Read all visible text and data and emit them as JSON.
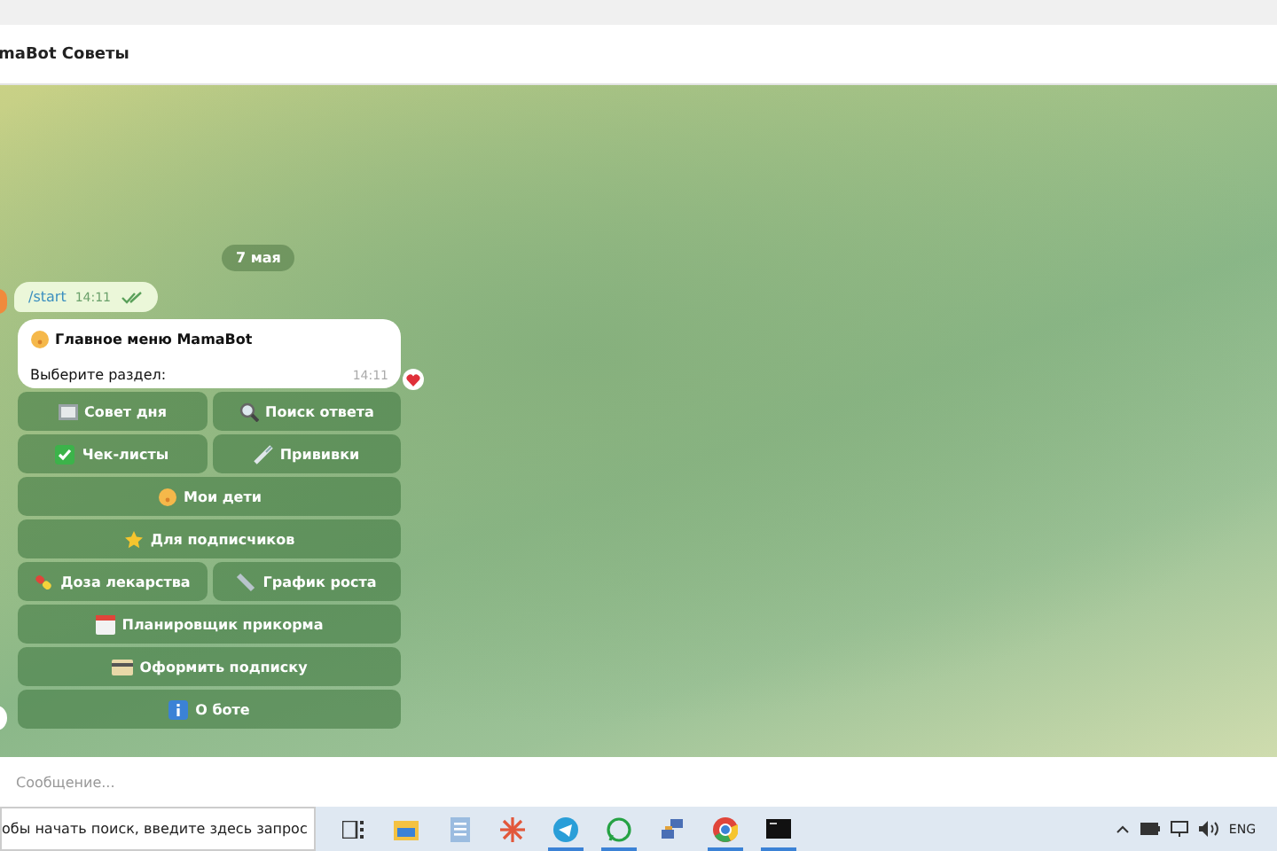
{
  "chat": {
    "title": "maBot Советы"
  },
  "date_badge": "7 мая",
  "outgoing": {
    "text": "/start",
    "time": "14:11",
    "read": true
  },
  "incoming": {
    "title": "Главное меню MamaBot",
    "text": "Выберите раздел:",
    "time": "14:11",
    "reacted": true
  },
  "keyboard": [
    [
      {
        "label": "Совет дня"
      },
      {
        "label": "Поиск ответа"
      }
    ],
    [
      {
        "label": "Чек-листы"
      },
      {
        "label": "Прививки"
      }
    ],
    [
      {
        "label": "Мои дети"
      }
    ],
    [
      {
        "label": "Для подписчиков"
      }
    ],
    [
      {
        "label": "Доза лекарства"
      },
      {
        "label": "График роста"
      }
    ],
    [
      {
        "label": "Планировщик прикорма"
      }
    ],
    [
      {
        "label": "Оформить подписку"
      }
    ],
    [
      {
        "label": "О боте"
      }
    ]
  ],
  "composer": {
    "placeholder": "Сообщение..."
  },
  "taskbar": {
    "search_placeholder": "обы начать поиск, введите здесь запрос",
    "language": "ENG"
  }
}
